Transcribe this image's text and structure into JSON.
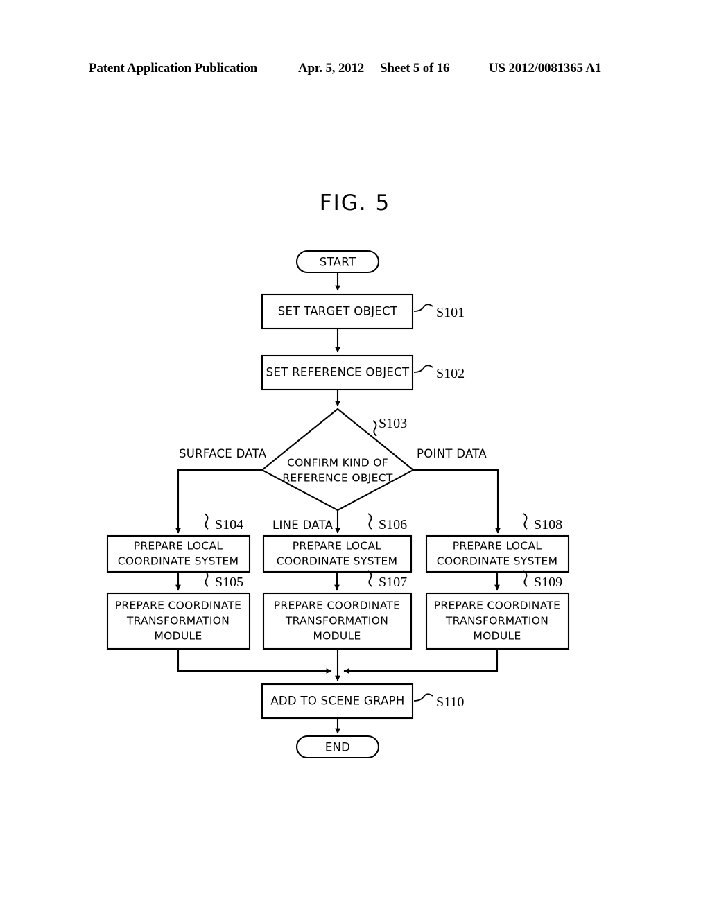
{
  "header": {
    "publication": "Patent Application Publication",
    "date": "Apr. 5, 2012",
    "sheet": "Sheet 5 of 16",
    "publication_number": "US 2012/0081365 A1"
  },
  "figure": {
    "title": "FIG. 5"
  },
  "flowchart": {
    "start_label": "START",
    "end_label": "END",
    "nodes": {
      "s101": {
        "text": "SET TARGET OBJECT",
        "step": "S101"
      },
      "s102": {
        "text": "SET REFERENCE OBJECT",
        "step": "S102"
      },
      "s103": {
        "line1": "CONFIRM KIND OF",
        "line2": "REFERENCE OBJECT",
        "step": "S103"
      },
      "s104": {
        "line1": "PREPARE LOCAL",
        "line2": "COORDINATE SYSTEM",
        "step": "S104"
      },
      "s105": {
        "line1": "PREPARE COORDINATE",
        "line2": "TRANSFORMATION",
        "line3": "MODULE",
        "step": "S105"
      },
      "s106": {
        "line1": "PREPARE LOCAL",
        "line2": "COORDINATE SYSTEM",
        "step": "S106"
      },
      "s107": {
        "line1": "PREPARE COORDINATE",
        "line2": "TRANSFORMATION",
        "line3": "MODULE",
        "step": "S107"
      },
      "s108": {
        "line1": "PREPARE LOCAL",
        "line2": "COORDINATE SYSTEM",
        "step": "S108"
      },
      "s109": {
        "line1": "PREPARE COORDINATE",
        "line2": "TRANSFORMATION",
        "line3": "MODULE",
        "step": "S109"
      },
      "s110": {
        "text": "ADD TO SCENE GRAPH",
        "step": "S110"
      }
    },
    "branches": {
      "left": "SURFACE DATA",
      "center": "LINE DATA",
      "right": "POINT DATA"
    }
  }
}
